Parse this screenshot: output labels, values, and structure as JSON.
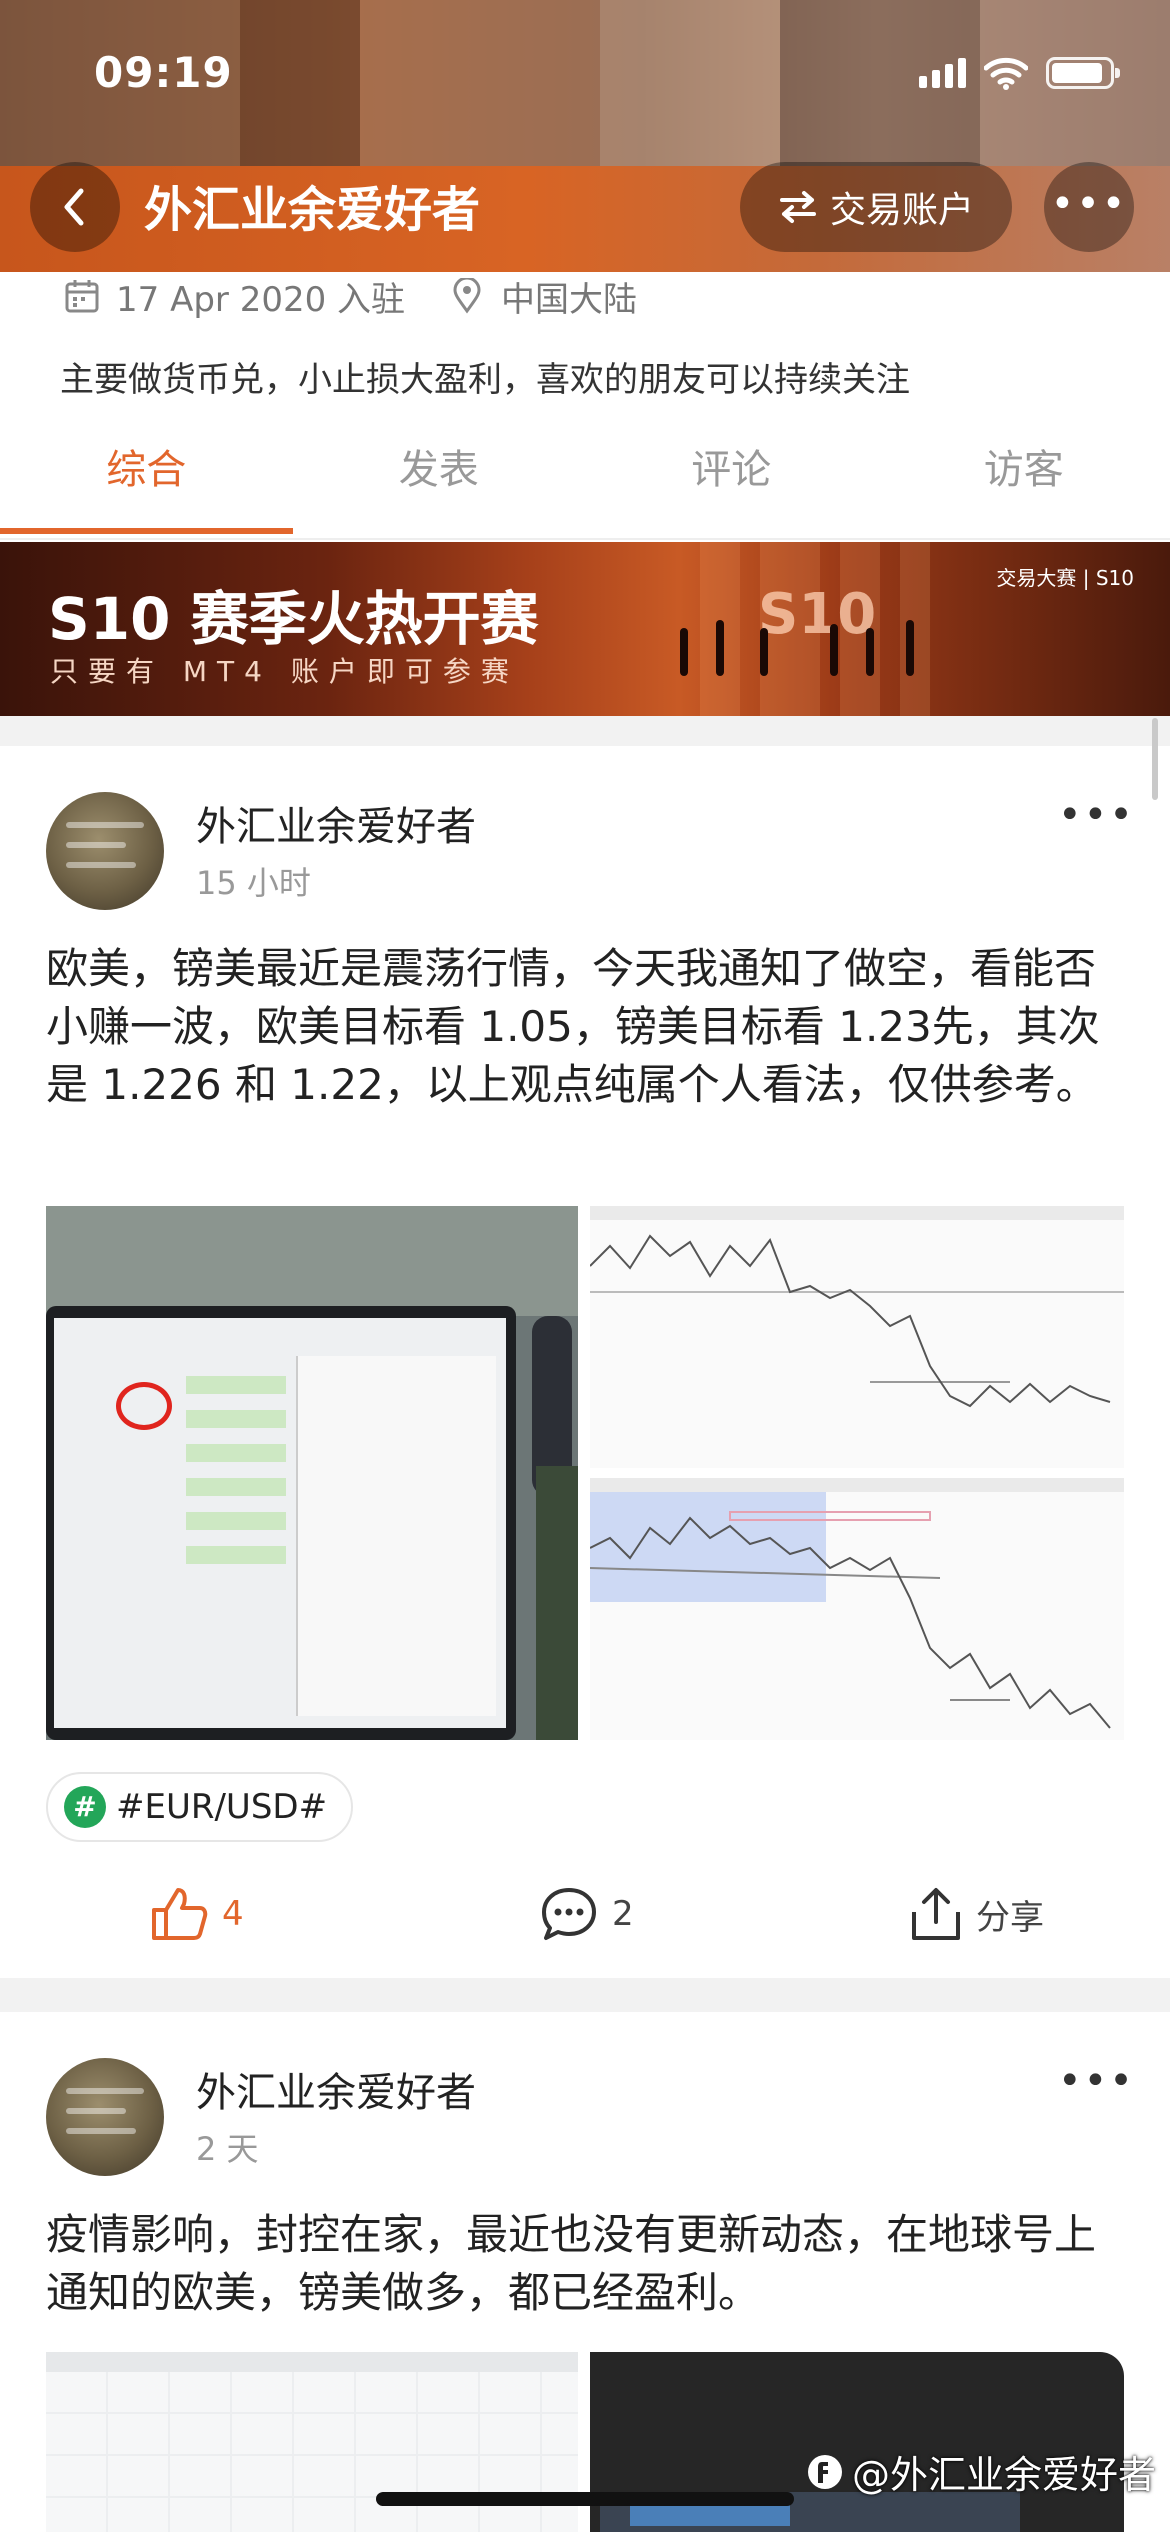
{
  "status_bar": {
    "time": "09:19"
  },
  "header": {
    "title": "外汇业余爱好者",
    "back_icon": "chevron-left-icon",
    "trade_button_label": "交易账户",
    "trade_icon": "swap-arrows-icon",
    "more_icon": "more-horizontal-icon"
  },
  "profile": {
    "join_date": "17 Apr 2020 入驻",
    "location": "中国大陆",
    "bio": "主要做货币兑，小止损大盈利，喜欢的朋友可以持续关注"
  },
  "tabs": [
    {
      "label": "综合",
      "active": true
    },
    {
      "label": "发表",
      "active": false
    },
    {
      "label": "评论",
      "active": false
    },
    {
      "label": "访客",
      "active": false
    }
  ],
  "banner": {
    "title": "S10 赛季火热开赛",
    "subtitle": "只要有 MT4 账户即可参赛",
    "badge": "S10",
    "brand": "交易大赛 | S10"
  },
  "posts": [
    {
      "author": "外汇业余爱好者",
      "time_ago": "15 小时",
      "text": "欧美，镑美最近是震荡行情，今天我通知了做空，看能否小赚一波，欧美目标看 1.05，镑美目标看 1.23先，其次是 1.226 和 1.22，以上观点纯属个人看法，仅供参考。",
      "tag": "#EUR/USD#",
      "likes": "4",
      "comments": "2",
      "share_label": "分享"
    },
    {
      "author": "外汇业余爱好者",
      "time_ago": "2 天",
      "text": "疫情影响，封控在家，最近也没有更新动态，在地球号上通知的欧美，镑美做多，都已经盈利。"
    }
  ],
  "watermark": "@外汇业余爱好者",
  "colors": {
    "accent": "#e2662c",
    "header_orange": "#d86424",
    "tag_green": "#23a659"
  }
}
